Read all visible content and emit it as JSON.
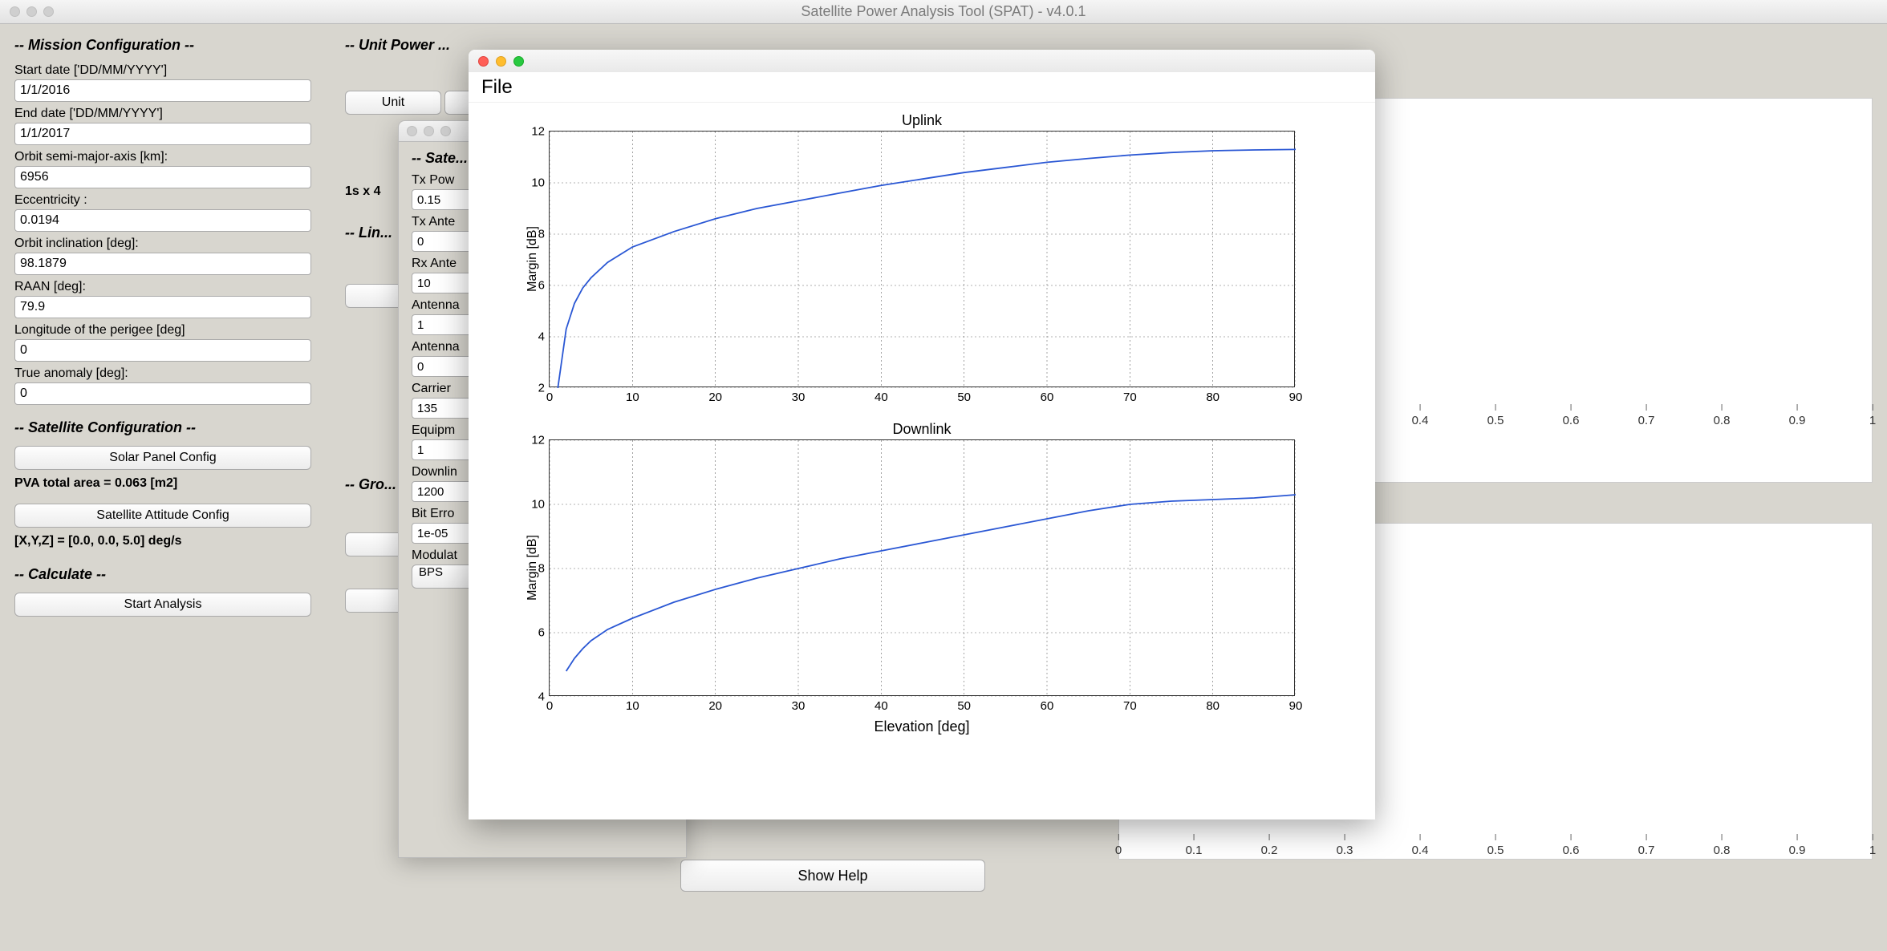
{
  "window": {
    "title": "Satellite Power Analysis Tool (SPAT) - v4.0.1"
  },
  "mission": {
    "header": "-- Mission Configuration --",
    "start_label": "Start date ['DD/MM/YYYY']",
    "start_value": "1/1/2016",
    "end_label": "End date ['DD/MM/YYYY']",
    "end_value": "1/1/2017",
    "sma_label": "Orbit semi-major-axis [km]:",
    "sma_value": "6956",
    "ecc_label": "Eccentricity :",
    "ecc_value": "0.0194",
    "inc_label": "Orbit inclination [deg]:",
    "inc_value": "98.1879",
    "raan_label": "RAAN [deg]:",
    "raan_value": "79.9",
    "lperi_label": "Longitude of the perigee [deg]",
    "lperi_value": "0",
    "tanom_label": "True anomaly [deg]:",
    "tanom_value": "0"
  },
  "satcfg": {
    "header": "-- Satellite Configuration --",
    "solar_btn": "Solar Panel Config",
    "pva_text": "PVA total area = 0.063 [m2]",
    "attitude_btn": "Satellite Attitude Config",
    "xyz_text": "[X,Y,Z] = [0.0, 0.0, 5.0] deg/s"
  },
  "calc": {
    "header": "-- Calculate --",
    "start_btn": "Start Analysis"
  },
  "mid": {
    "header": "-- Unit Power ...",
    "unit_btn": "Unit",
    "dim_text": "1s x 4",
    "lin_header": "-- Lin...",
    "gro_header": "-- Gro..."
  },
  "help": {
    "show": "Show Help"
  },
  "bg_axis": {
    "ticks": [
      "0",
      "0.1",
      "0.2",
      "0.3",
      "0.4",
      "0.5",
      "0.6",
      "0.7",
      "0.8",
      "0.9",
      "1"
    ]
  },
  "win3": {
    "header": "-- Sate...",
    "txpow_lbl": "Tx Pow",
    "txpow_val": "0.15",
    "txant_lbl": "Tx Ante",
    "txant_val": "0",
    "rxant_lbl": "Rx Ante",
    "rxant_val": "10",
    "ant1_lbl": "Antenna",
    "ant1_val": "1",
    "ant2_lbl": "Antenna",
    "ant2_val": "0",
    "carr_lbl": "Carrier ",
    "carr_val": "135",
    "equip_lbl": "Equipm",
    "equip_val": "1",
    "down_lbl": "Downlin",
    "down_val": "1200",
    "ber_lbl": "Bit Erro",
    "ber_val": "1e-05",
    "mod_lbl": "Modulat",
    "mod_val": "BPS"
  },
  "chartwin": {
    "file_menu": "File",
    "uplink_title": "Uplink",
    "downlink_title": "Downlink",
    "ylabel": "Margin [dB]",
    "xlabel": "Elevation [deg]"
  },
  "chart_data": [
    {
      "type": "line",
      "title": "Uplink",
      "xlabel": "Elevation [deg]",
      "ylabel": "Margin [dB]",
      "xlim": [
        0,
        90
      ],
      "ylim": [
        2,
        12
      ],
      "xticks": [
        0,
        10,
        20,
        30,
        40,
        50,
        60,
        70,
        80,
        90
      ],
      "yticks": [
        2,
        4,
        6,
        8,
        10,
        12
      ],
      "series": [
        {
          "name": "Uplink",
          "x": [
            1,
            2,
            3,
            4,
            5,
            7,
            10,
            15,
            20,
            25,
            30,
            35,
            40,
            45,
            50,
            55,
            60,
            65,
            70,
            75,
            80,
            85,
            90
          ],
          "y": [
            2.0,
            4.3,
            5.3,
            5.9,
            6.3,
            6.9,
            7.5,
            8.1,
            8.6,
            9.0,
            9.3,
            9.6,
            9.9,
            10.15,
            10.4,
            10.6,
            10.8,
            10.95,
            11.08,
            11.18,
            11.25,
            11.28,
            11.3
          ]
        }
      ]
    },
    {
      "type": "line",
      "title": "Downlink",
      "xlabel": "Elevation [deg]",
      "ylabel": "Margin [dB]",
      "xlim": [
        0,
        90
      ],
      "ylim": [
        4,
        12
      ],
      "xticks": [
        0,
        10,
        20,
        30,
        40,
        50,
        60,
        70,
        80,
        90
      ],
      "yticks": [
        4,
        6,
        8,
        10,
        12
      ],
      "series": [
        {
          "name": "Downlink",
          "x": [
            2,
            3,
            4,
            5,
            7,
            10,
            15,
            20,
            25,
            30,
            35,
            40,
            45,
            50,
            55,
            60,
            65,
            70,
            75,
            80,
            85,
            90
          ],
          "y": [
            4.8,
            5.2,
            5.5,
            5.75,
            6.1,
            6.45,
            6.95,
            7.35,
            7.7,
            8.0,
            8.3,
            8.55,
            8.8,
            9.05,
            9.3,
            9.55,
            9.8,
            10.0,
            10.1,
            10.15,
            10.2,
            10.3
          ]
        }
      ]
    }
  ]
}
